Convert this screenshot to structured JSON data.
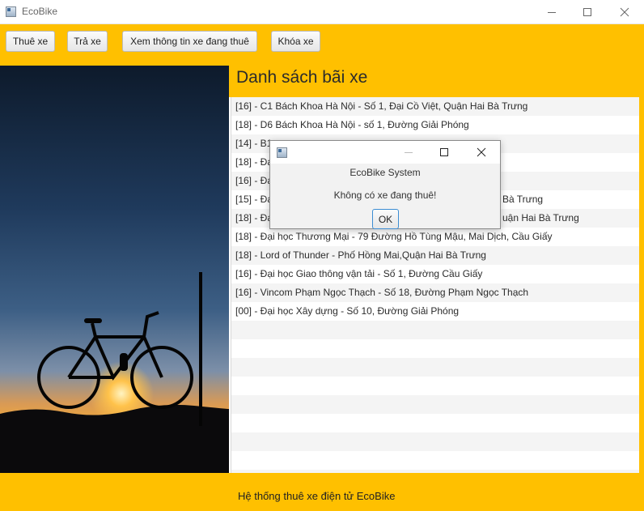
{
  "window": {
    "title": "EcoBike",
    "icon": "app-window-icon",
    "controls": [
      "minimize-icon",
      "maximize-icon",
      "close-icon"
    ]
  },
  "toolbar": {
    "buttons": [
      {
        "label": "Thuê xe"
      },
      {
        "label": "Trả xe"
      },
      {
        "label": "Xem thông tin xe đang thuê"
      },
      {
        "label": "Khóa xe"
      }
    ]
  },
  "list_panel": {
    "heading": "Danh sách bãi xe",
    "items": [
      "[16] - C1 Bách Khoa Hà Nội - Số 1, Đại Cồ Việt, Quận Hai Bà Trưng",
      "[18] - D6 Bách Khoa Hà Nội - số 1, Đường Giải Phóng",
      "[14] - B1",
      "[18] - Đạ",
      "[16] - Đạ",
      "[15] - Đạ",
      "[18] - Đạ",
      "[18] - Đại học Thương Mại - 79 Đường Hồ Tùng Mậu, Mai Dịch, Cầu Giấy",
      "[18] - Lord of Thunder - Phố Hồng Mai,Quận Hai Bà Trưng",
      "[16] - Đại học Giao thông vận tải - Số 1, Đường Cầu Giấy",
      "[16] - Vincom Phạm Ngọc Thạch - Số 18, Đường Phạm Ngọc Thạch",
      "[00] - Đại học Xây dựng - Số 10, Đường Giải Phóng"
    ],
    "partial_tails": {
      "row6": "Bà Trưng",
      "row7": "uận Hai Bà Trưng"
    }
  },
  "footer": {
    "text": "Hệ thống thuê xe điện tử EcoBike"
  },
  "dialog": {
    "header": "EcoBike System",
    "message": "Không có xe đang thuê!",
    "ok_label": "OK"
  },
  "colors": {
    "accent": "#ffc000",
    "row_stripe": "#f4f4f4",
    "focus_border": "#3c8dd3"
  }
}
